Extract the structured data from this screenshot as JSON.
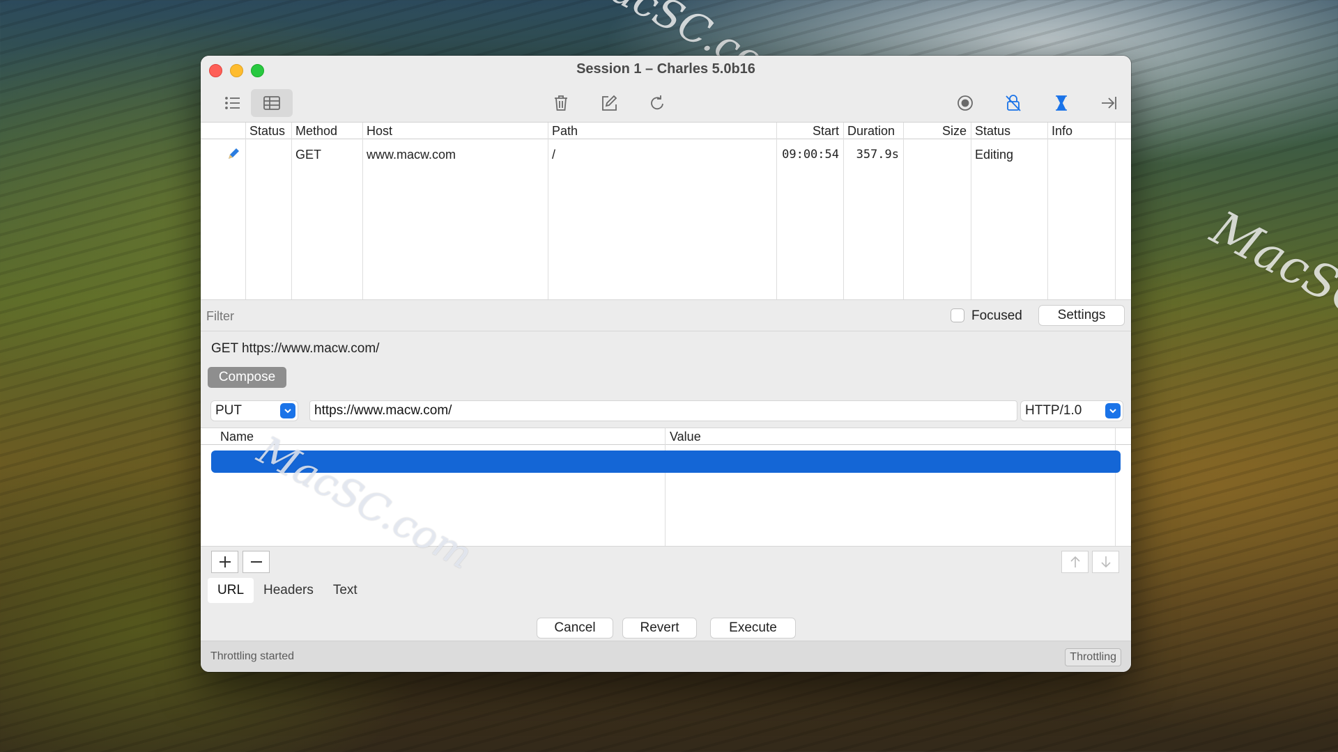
{
  "background": {
    "watermark": "MacSC.com"
  },
  "window": {
    "title": "Session 1 – Charles 5.0b16",
    "toolbar": {
      "icons": [
        "list-view-icon",
        "table-view-icon",
        "trash-icon",
        "edit-icon",
        "refresh-icon",
        "record-icon",
        "ssl-proxy-icon",
        "throttle-icon",
        "breakpoint-icon"
      ]
    }
  },
  "session_table": {
    "columns": [
      "Status",
      "Method",
      "Host",
      "Path",
      "Start",
      "Duration",
      "Size",
      "Status",
      "Info"
    ],
    "rows": [
      {
        "status": "",
        "method": "GET",
        "host": "www.macw.com",
        "path": "/",
        "start": "09:00:54",
        "duration": "357.9s",
        "size": "",
        "status2": "Editing",
        "info": ""
      }
    ]
  },
  "filter": {
    "placeholder": "Filter",
    "focused_label": "Focused",
    "settings_label": "Settings"
  },
  "compose": {
    "request_line": "GET https://www.macw.com/",
    "compose_label": "Compose",
    "method": "PUT",
    "url": "https://www.macw.com/",
    "protocol": "HTTP/1.0",
    "params_columns": {
      "name": "Name",
      "value": "Value"
    },
    "tabs": [
      "URL",
      "Headers",
      "Text"
    ],
    "actions": {
      "cancel": "Cancel",
      "revert": "Revert",
      "execute": "Execute"
    }
  },
  "statusbar": {
    "text": "Throttling started",
    "throttling_label": "Throttling"
  },
  "colors": {
    "accent": "#1a73e8",
    "selection": "#1466d6"
  }
}
